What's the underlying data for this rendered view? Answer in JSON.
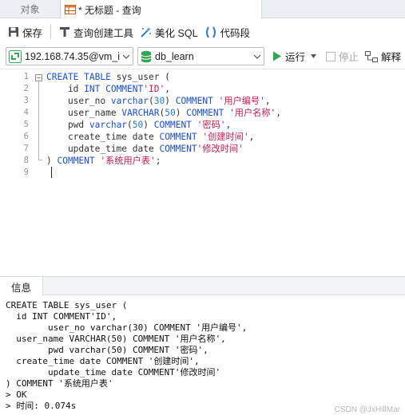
{
  "tabs": {
    "objects_label": "对象",
    "query_label": "* 无标题 - 查询"
  },
  "toolbar": {
    "save_label": "保存",
    "query_builder_label": "查询创建工具",
    "beautify_label": "美化 SQL",
    "snippet_label": "代码段"
  },
  "runbar": {
    "connection_value": "192.168.74.35@vm_i",
    "database_value": "db_learn",
    "run_label": "运行",
    "stop_label": "停止",
    "explain_label": "解释"
  },
  "editor": {
    "line_numbers": [
      "1",
      "2",
      "3",
      "4",
      "5",
      "6",
      "7",
      "8",
      "9"
    ]
  },
  "info": {
    "tab_label": "信息",
    "lines": [
      "CREATE TABLE sys_user (",
      "  id INT COMMENT'ID',",
      "        user_no varchar(30) COMMENT '用户编号',",
      "  user_name VARCHAR(50) COMMENT '用户名称',",
      "        pwd varchar(50) COMMENT '密码',",
      "  create_time date COMMENT '创建时间',",
      "        update_time date COMMENT'修改时间'",
      ") COMMENT '系统用户表'",
      "> OK",
      "> 时间: 0.074s"
    ]
  },
  "watermark": "CSDN @JxHillMar",
  "colors": {
    "keyword": "#1a4fd6",
    "string": "#c9184a",
    "number": "#1e7ad3",
    "run_green": "#2fa84f"
  }
}
